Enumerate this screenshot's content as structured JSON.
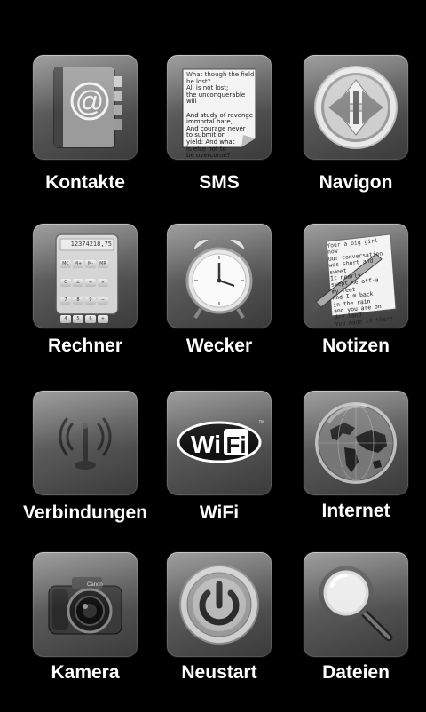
{
  "apps": [
    {
      "label": "Kontakte"
    },
    {
      "label": "SMS"
    },
    {
      "label": "Navigon"
    },
    {
      "label": "Rechner"
    },
    {
      "label": "Wecker"
    },
    {
      "label": "Notizen"
    },
    {
      "label": "Verbindungen"
    },
    {
      "label": "WiFi"
    },
    {
      "label": "Internet"
    },
    {
      "label": "Kamera"
    },
    {
      "label": "Neustart"
    },
    {
      "label": "Dateien"
    }
  ],
  "icons": {
    "sms_text": "What though the field be lost?\nAll is not lost;\nthe unconquerable will\n\nAnd study of revenge\nimmortal hate,\nAnd courage never\nto submit or\nyield: And what\nis else not to\nbe overcome?",
    "calc_display": "12374218,75",
    "calc_keys": [
      "MC",
      "M+",
      "M-",
      "MR",
      "C",
      "±",
      "÷",
      "×",
      "7",
      "8",
      "9",
      "−",
      "4",
      "5",
      "6",
      "+",
      "1",
      "2",
      "3",
      "=",
      "0",
      "",
      ",",
      ""
    ],
    "notes_text": "Your a big girl\nnow\nOur conversation\nwas short and\nsweet\nIt nearly\nswept me off-a\nmy feet\nAnd I'm back\nin the rain\nand you are on\ndry land\nYou made it there\nsomehow\nYou're a big girl\nnow.",
    "wifi_text": "WiFi",
    "camera_brand": "Canon"
  }
}
